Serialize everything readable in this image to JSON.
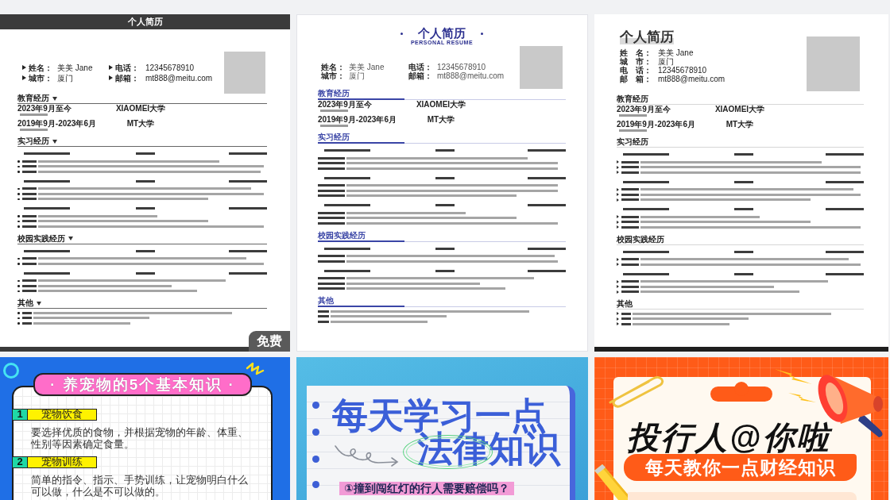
{
  "templates": [
    {
      "kind": "dark",
      "title": "个人简历",
      "badge": "免费",
      "info": [
        {
          "label": "姓名：",
          "value": "美美 Jane"
        },
        {
          "label": "电话：",
          "value": "12345678910"
        },
        {
          "label": "城市：",
          "value": "厦门"
        },
        {
          "label": "邮箱：",
          "value": "mt888@meitu.com"
        }
      ],
      "sections": [
        {
          "kind": "education",
          "heading": "教育经历",
          "entries": [
            {
              "date": "2023年9月至今",
              "school": "XIAOMEI大学"
            },
            {
              "date": "2019年9月-2023年6月",
              "school": "MT大学"
            }
          ]
        },
        {
          "kind": "internship",
          "heading": "实习经历"
        },
        {
          "kind": "campus",
          "heading": "校园实践经历"
        },
        {
          "kind": "other",
          "heading": "其他"
        }
      ]
    },
    {
      "kind": "blue",
      "title": "个人简历",
      "subtitle": "PERSONAL RESUME",
      "info": [
        {
          "label": "姓名：",
          "value": "美美 Jane"
        },
        {
          "label": "电话：",
          "value": "12345678910"
        },
        {
          "label": "城市：",
          "value": "厦门"
        },
        {
          "label": "邮箱：",
          "value": "mt888@meitu.com"
        }
      ],
      "sections": [
        {
          "kind": "education",
          "heading": "教育经历",
          "entries": [
            {
              "date": "2023年9月至今",
              "school": "XIAOMEI大学"
            },
            {
              "date": "2019年9月-2023年6月",
              "school": "MT大学"
            }
          ]
        },
        {
          "kind": "internship",
          "heading": "实习经历"
        },
        {
          "kind": "campus",
          "heading": "校园实践经历"
        },
        {
          "kind": "other",
          "heading": "其他"
        }
      ]
    },
    {
      "kind": "plain",
      "title": "个人简历",
      "info": [
        {
          "label": "姓　名：",
          "value": "美美 Jane"
        },
        {
          "label": "城　市：",
          "value": "厦门"
        },
        {
          "label": "电　话：",
          "value": "12345678910"
        },
        {
          "label": "邮　箱：",
          "value": "mt888@meitu.com"
        }
      ],
      "sections": [
        {
          "kind": "education",
          "heading": "教育经历",
          "entries": [
            {
              "date": "2023年9月至今",
              "school": "XIAOMEI大学"
            },
            {
              "date": "2019年9月-2023年6月",
              "school": "MT大学"
            }
          ]
        },
        {
          "kind": "internship",
          "heading": "实习经历"
        },
        {
          "kind": "campus",
          "heading": "校园实践经历"
        },
        {
          "kind": "other",
          "heading": "其他"
        }
      ]
    }
  ],
  "posters": [
    {
      "kind": "pet",
      "title": "· 养宠物的5个基本知识 ·",
      "items": [
        {
          "number": "1",
          "heading": "宠物饮食",
          "text": "要选择优质的食物，并根据宠物的年龄、体重、性别等因素确定食量。"
        },
        {
          "number": "2",
          "heading": "宠物训练",
          "text": "简单的指令、指示、手势训练，让宠物明白什么可以做，什么是不可以做的。"
        }
      ]
    },
    {
      "kind": "law",
      "headline": [
        "每天学习一点",
        "法律知识"
      ],
      "tag": "①撞到闯红灯的行人需要赔偿吗？"
    },
    {
      "kind": "finance",
      "title": "投行人@你啦",
      "banner": "每天教你一点财经知识"
    }
  ]
}
